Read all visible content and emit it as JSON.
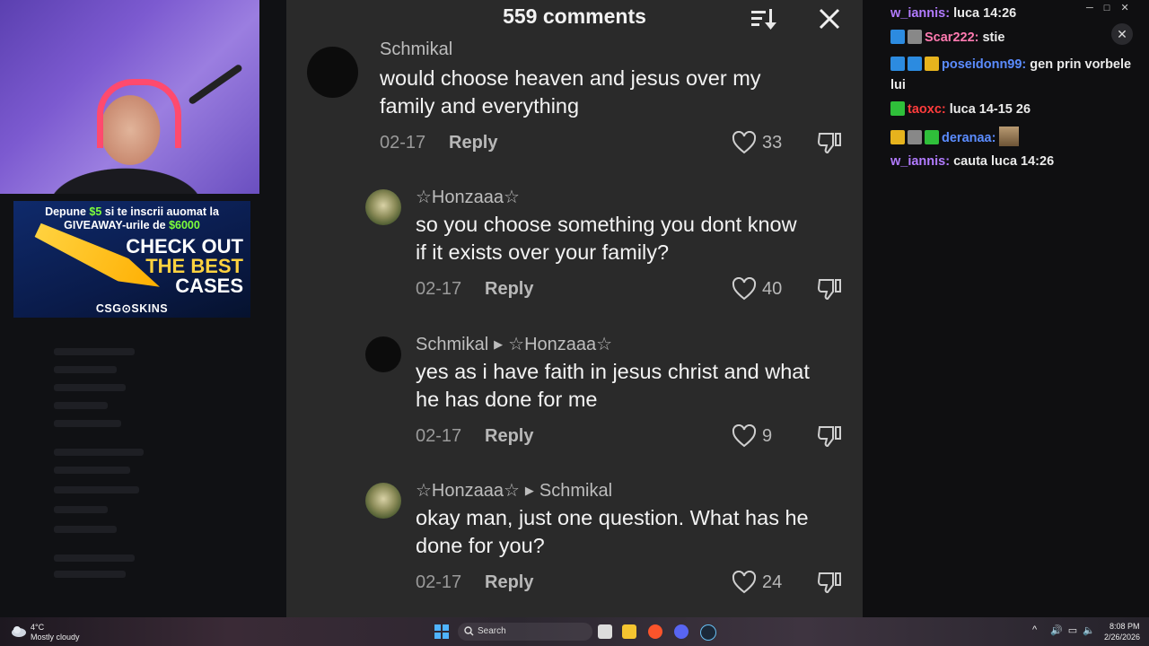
{
  "comments_panel": {
    "title": "559 comments",
    "comments": [
      {
        "user": "Schmikal",
        "reply_to": "",
        "text_line1": "would choose heaven and jesus over my",
        "text_line2": "family and everything",
        "date": "02-17",
        "reply_label": "Reply",
        "likes": "33"
      },
      {
        "user": "☆Honzaaa☆",
        "reply_to": "",
        "text_line1": "so you choose something you dont know",
        "text_line2": "if it exists over your family?",
        "date": "02-17",
        "reply_label": "Reply",
        "likes": "40"
      },
      {
        "user": "Schmikal",
        "reply_to": "☆Honzaaa☆",
        "text_line1": "yes as i have faith in jesus christ and what",
        "text_line2": "he has done for me",
        "date": "02-17",
        "reply_label": "Reply",
        "likes": "9"
      },
      {
        "user": "☆Honzaaa☆",
        "reply_to": "Schmikal",
        "text_line1": "okay man, just one question. What has he",
        "text_line2": "done for you?",
        "date": "02-17",
        "reply_label": "Reply",
        "likes": "24"
      }
    ]
  },
  "ad": {
    "line1_a": "Depune ",
    "line1_money": "$5",
    "line1_b": " si te inscrii auomat la",
    "line2_a": "GIVEAWAY-urile de ",
    "line2_money": "$6000",
    "headline1": "CHECK OUT",
    "headline2": "THE BEST",
    "headline3": "CASES",
    "brand": "CSG⊙SKINS"
  },
  "chat": {
    "messages": [
      {
        "user": "w_iannis:",
        "text": " luca 14:26"
      },
      {
        "user": "Scar222:",
        "text": " stie"
      },
      {
        "user": "poseidonn99:",
        "text": " gen prin vorbele lui"
      },
      {
        "user": "taoxc:",
        "text": " luca 14-15 26"
      },
      {
        "user": "deranaa:",
        "text": ""
      },
      {
        "user": "w_iannis:",
        "text": " cauta luca 14:26"
      }
    ]
  },
  "taskbar": {
    "temp": "4°C",
    "weather": "Mostly cloudy",
    "search": "Search",
    "time": "8:08 PM",
    "date": "2/26/2026"
  }
}
